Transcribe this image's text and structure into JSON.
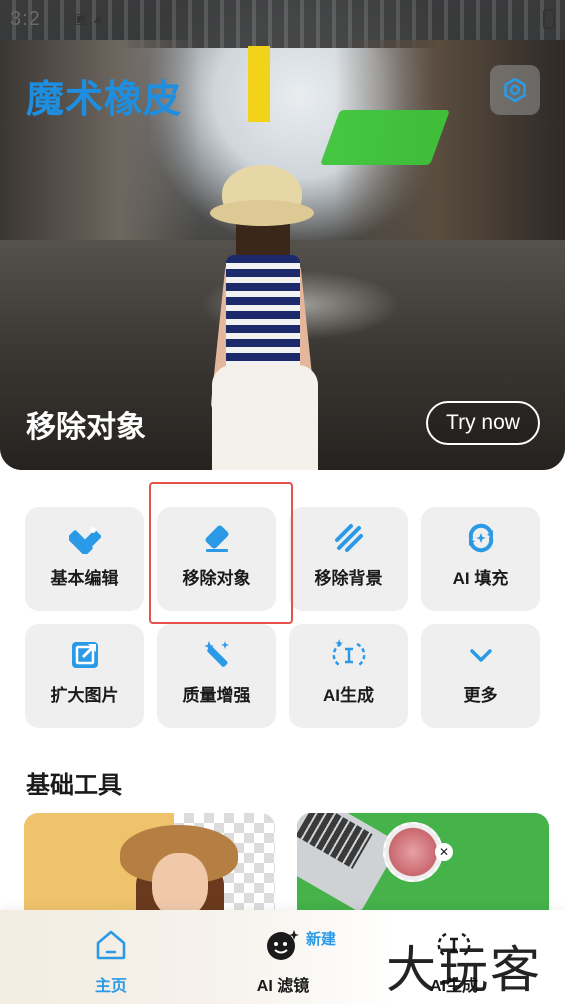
{
  "status_bar": {
    "time": "3:2",
    "left_glyphs": "▣ ▲"
  },
  "header": {
    "app_title": "魔术橡皮",
    "settings_icon": "gear-icon"
  },
  "hero": {
    "feature_label": "移除对象",
    "try_button": "Try now"
  },
  "tools": [
    {
      "label": "基本编辑",
      "icon": "edit-pencil-icon"
    },
    {
      "label": "移除对象",
      "icon": "eraser-icon",
      "highlighted": true
    },
    {
      "label": "移除背景",
      "icon": "remove-background-icon"
    },
    {
      "label": "AI 填充",
      "icon": "ai-fill-icon"
    },
    {
      "label": "扩大图片",
      "icon": "expand-image-icon"
    },
    {
      "label": "质量增强",
      "icon": "magic-wand-icon"
    },
    {
      "label": "AI生成",
      "icon": "ai-generate-icon"
    },
    {
      "label": "更多",
      "icon": "chevron-down-icon"
    }
  ],
  "basic_tools": {
    "title": "基础工具"
  },
  "bottom_nav": {
    "items": [
      {
        "label": "主页",
        "icon": "home-icon",
        "active": true
      },
      {
        "label": "AI 滤镜",
        "icon": "ai-filter-icon",
        "badge": "新建"
      },
      {
        "label": "AI生成",
        "icon": "ai-generate-icon"
      }
    ]
  },
  "watermark": "大玩客",
  "colors": {
    "accent": "#2b9ae6",
    "title_blue": "#1e8fe0",
    "highlight_red": "#e5524a",
    "tile_bg": "#efefef"
  }
}
